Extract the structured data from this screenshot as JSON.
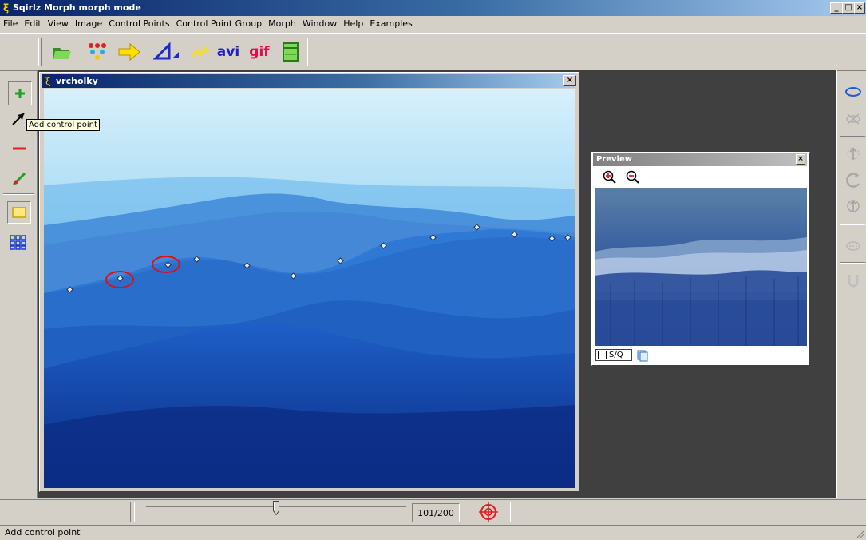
{
  "app": {
    "title": "Sqirlz Morph   morph mode"
  },
  "menu": [
    "File",
    "Edit",
    "View",
    "Image",
    "Control Points",
    "Control Point Group",
    "Morph",
    "Window",
    "Help",
    "Examples"
  ],
  "toolbar": {
    "avi_label": "avi",
    "gif_label": "gif",
    "icons": [
      "open-folder-icon",
      "control-points-icon",
      "arrow-right-icon",
      "triangle-icon",
      "wave-icon",
      "avi-export-icon",
      "gif-export-icon",
      "window-icon"
    ]
  },
  "left_palette": [
    "add-point-icon",
    "cursor-icon",
    "delete-point-icon",
    "move-point-icon",
    "rectangle-select-icon",
    "grid-icon"
  ],
  "tooltip": "Add control point",
  "image_window": {
    "title": "vrcholky",
    "close": "×"
  },
  "preview": {
    "title": "Preview",
    "sq_label": "S/Q",
    "close": "×"
  },
  "right_palette": [
    "ellipse-icon",
    "no-select-icon",
    "up-arrow-icon",
    "rotate-icon",
    "up-arrow-2-icon",
    "ellipsis-icon",
    "u-icon"
  ],
  "slider": {
    "value": 101,
    "total": 200,
    "readout": "101/200",
    "fraction": 0.5
  },
  "status": "Add control point"
}
